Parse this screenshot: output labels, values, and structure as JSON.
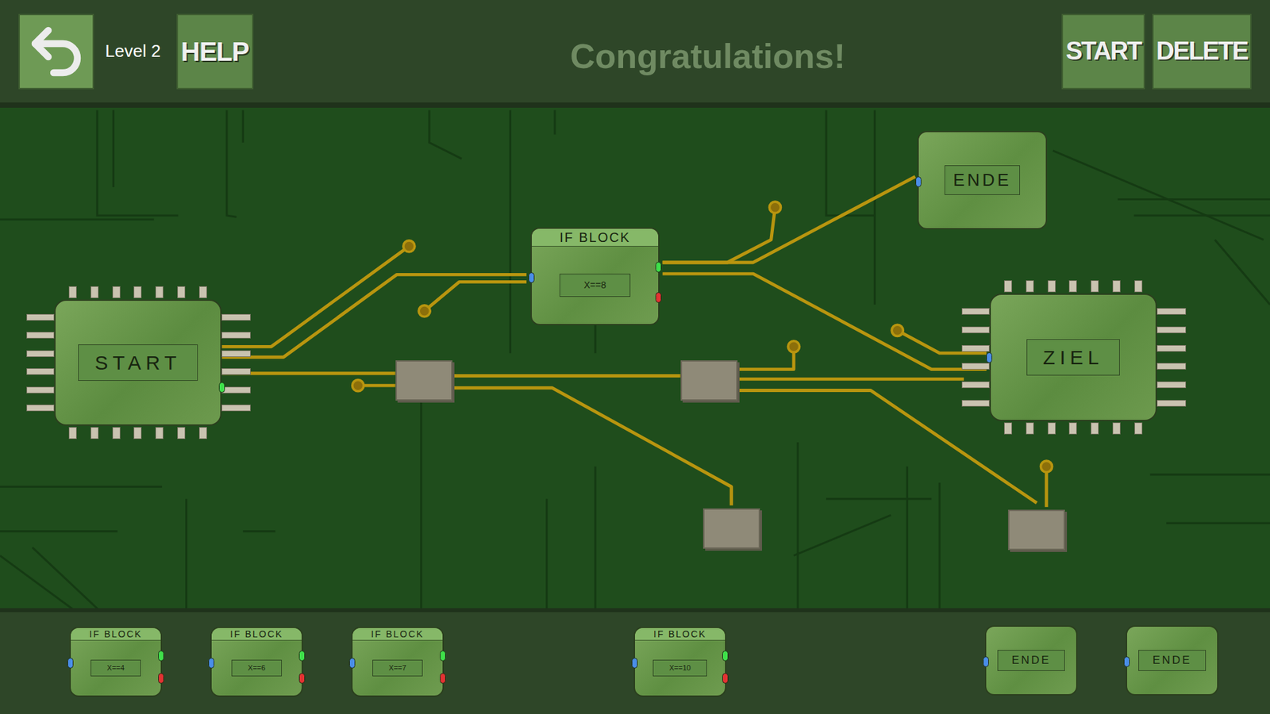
{
  "header": {
    "level": "Level 2",
    "help": "HELP",
    "message": "Congratulations!",
    "buttons": [
      "START",
      "DELETE"
    ]
  },
  "board": {
    "start": {
      "label": "START"
    },
    "if_block": {
      "title": "IF BLOCK",
      "condition": "X==8"
    },
    "ende": {
      "label": "ENDE"
    },
    "ziel": {
      "label": "ZIEL"
    }
  },
  "palette": [
    {
      "kind": "if",
      "title": "IF BLOCK",
      "condition": "X==4"
    },
    {
      "kind": "if",
      "title": "IF BLOCK",
      "condition": "X==6"
    },
    {
      "kind": "if",
      "title": "IF BLOCK",
      "condition": "X==7"
    },
    {
      "kind": "if",
      "title": "IF BLOCK",
      "condition": "X==10"
    },
    {
      "kind": "ende",
      "label": "ENDE"
    },
    {
      "kind": "ende",
      "label": "ENDE"
    }
  ]
}
